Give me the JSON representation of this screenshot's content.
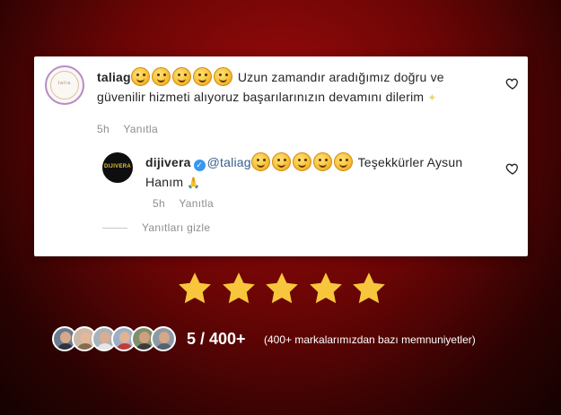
{
  "comments": [
    {
      "username": "taliag",
      "emoji_count": 5,
      "body": "Uzun zamandır aradığımız doğru ve güvenilir hizmeti alıyoruz başarılarınızın devamını dilerim",
      "trailing_emoji": "sparkles",
      "time": "5h",
      "reply_label": "Yanıtla",
      "avatar_text": "talia"
    },
    {
      "username": "dijivera",
      "verified": true,
      "mention": "@taliag",
      "emoji_count": 5,
      "body_first_line": "Teşekkürler Aysun",
      "body_second_line": "Hanım",
      "trailing_emoji": "pray",
      "time": "5h",
      "reply_label": "Yanıtla",
      "avatar_text": "DIJIVERA"
    }
  ],
  "hide_replies_label": "Yanıtları gizle",
  "rating": {
    "stars": 5,
    "score_text": "5 / 400+",
    "caption": "(400+ markalarımızdan bazı memnuniyetler)",
    "star_color": "#f7c63c"
  },
  "faces_count": 6,
  "colors": {
    "background": "#6a0505",
    "card": "#ffffff",
    "muted": "#8e8e8e",
    "verified": "#3897f0"
  }
}
